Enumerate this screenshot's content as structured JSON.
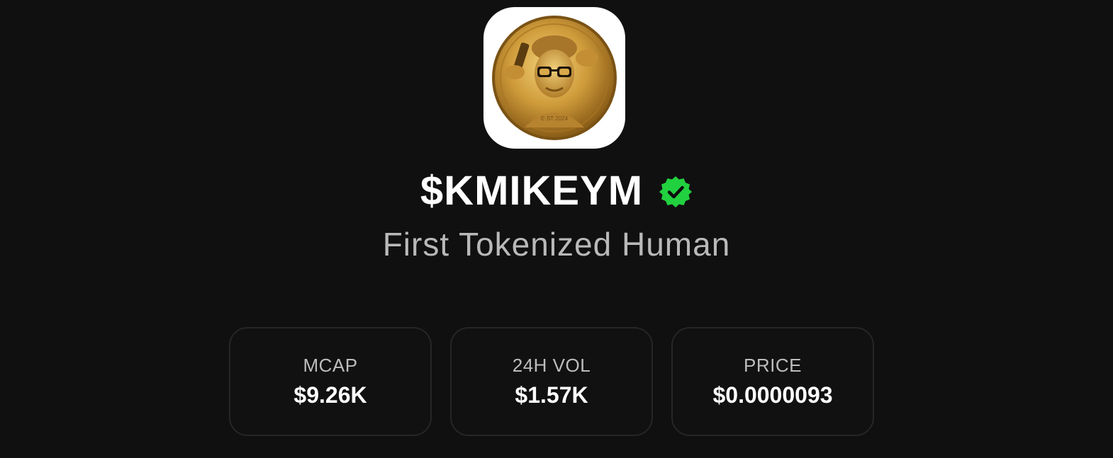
{
  "token": {
    "name": "$KMIKEYM",
    "tagline": "First Tokenized Human",
    "verified": true,
    "logo_icon": "gold-coin-portrait-icon",
    "verified_icon": "verified-check-icon"
  },
  "stats": [
    {
      "label": "MCAP",
      "value": "$9.26K"
    },
    {
      "label": "24H VOL",
      "value": "$1.57K"
    },
    {
      "label": "PRICE",
      "value": "$0.0000093"
    }
  ],
  "colors": {
    "background": "#101010",
    "verified_green": "#22d13f",
    "card_border": "#262626",
    "subtitle": "#b9b9b9",
    "coin_gold": "#c9962f"
  }
}
